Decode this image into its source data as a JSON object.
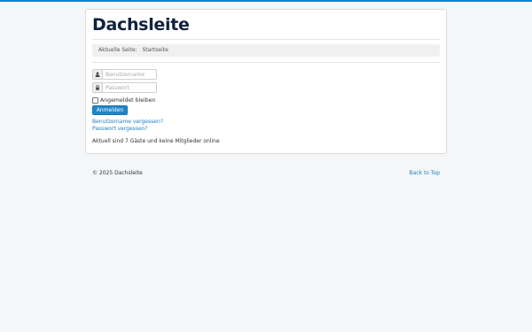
{
  "site": {
    "title": "Dachsleite"
  },
  "breadcrumb": {
    "label": "Aktuelle Seite:",
    "current": "Startseite"
  },
  "login": {
    "username_placeholder": "Benutzername",
    "password_placeholder": "Passwort",
    "remember_label": "Angemeldet bleiben",
    "remember_checked": false,
    "submit_label": "Anmelden",
    "forgot_username": "Benutzername vergessen?",
    "forgot_password": "Passwort vergessen?"
  },
  "online_status": "Aktuell sind 7 Gäste und keine Mitglieder online",
  "footer": {
    "copyright": "© 2025 Dachsleite",
    "back_to_top": "Back to Top"
  },
  "icons": {
    "username": "user-icon",
    "password": "lock-icon"
  },
  "colors": {
    "accent": "#0088cc",
    "button": "#1f86c8",
    "link": "#1a82c4",
    "title": "#10223e"
  }
}
